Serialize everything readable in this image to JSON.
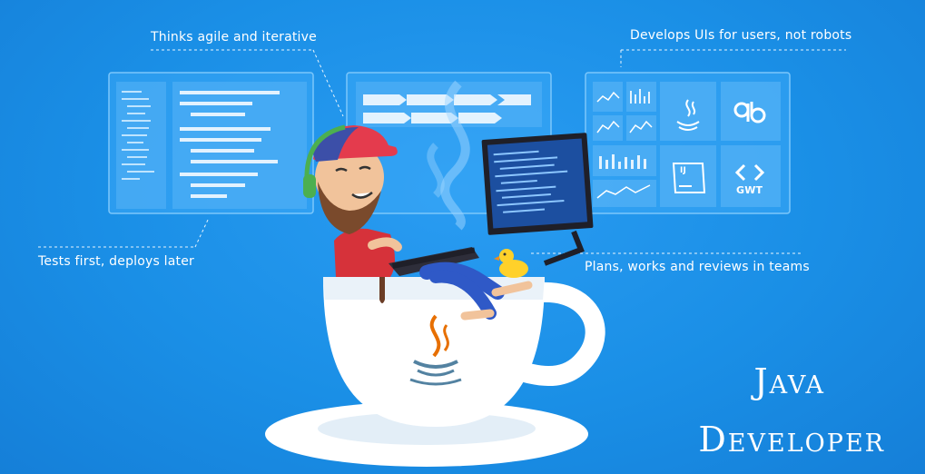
{
  "callouts": {
    "agile": "Thinks agile and iterative",
    "users": "Develops UIs for users, not robots",
    "tests": "Tests first, deploys later",
    "teams": "Plans, works and reviews in teams"
  },
  "title": {
    "line1": "Java",
    "line2": "Developer"
  },
  "tiles": {
    "ij": "IJ",
    "gwt": "GWT"
  },
  "colors": {
    "background": "#1a8fe6",
    "panel": "#3aa7f5",
    "text": "#ffffff",
    "cap": "#ffffff",
    "java_orange": "#e76f00",
    "java_blue": "#5382a1"
  }
}
